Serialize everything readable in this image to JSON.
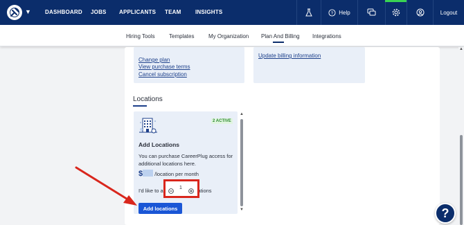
{
  "topnav": {
    "links": [
      "DASHBOARD",
      "JOBS",
      "APPLICANTS",
      "TEAM",
      "INSIGHTS"
    ],
    "help_label": "Help",
    "logout_label": "Logout",
    "accent_green": "#39d353",
    "bg_color": "#0b2d6b"
  },
  "subnav": {
    "links": [
      "Hiring Tools",
      "Templates",
      "My Organization",
      "Plan And Billing",
      "Integrations"
    ],
    "active": "Plan And Billing"
  },
  "plan": {
    "links": [
      "Change plan",
      "View purchase terms",
      "Cancel subscription"
    ]
  },
  "billing": {
    "update_link": "Update billing information"
  },
  "locations": {
    "section_title": "Locations",
    "badge": "2 ACTIVE",
    "title": "Add Locations",
    "description": "You can purchase CareerPlug access for additional locations here.",
    "price_symbol": "$",
    "price_suffix": "/location per month",
    "like_prefix": "I'd like to ad",
    "like_suffix": "cations",
    "quantity": "1",
    "add_button": "Add locations"
  },
  "help_fab": "?",
  "colors": {
    "highlight_red": "#d9261c",
    "button_blue": "#1a56d6"
  }
}
